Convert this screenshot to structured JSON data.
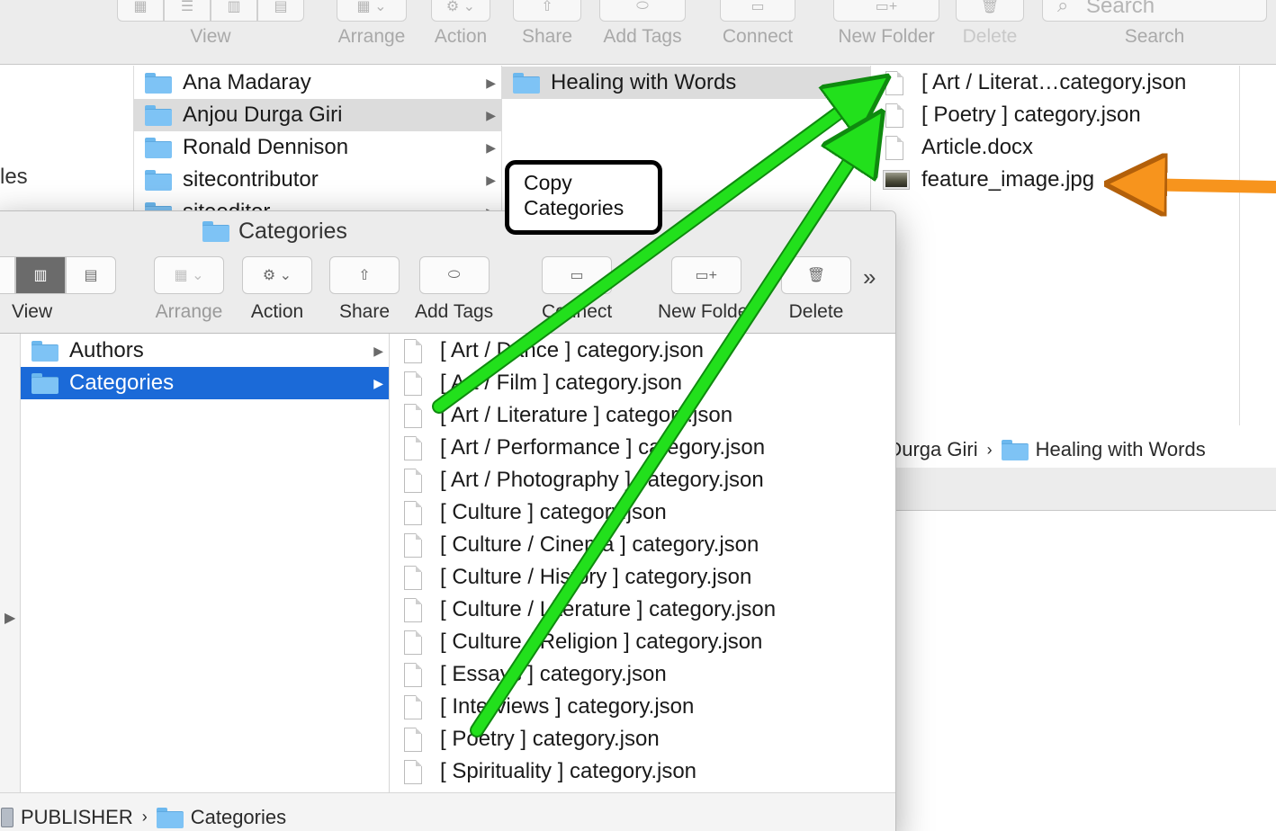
{
  "back_window": {
    "toolbar": {
      "view": "View",
      "arrange": "Arrange",
      "action": "Action",
      "share": "Share",
      "add_tags": "Add Tags",
      "connect": "Connect",
      "new_folder": "New Folder",
      "delete": "Delete",
      "search_placeholder": "Search",
      "search_label": "Search"
    },
    "sidebar_fragment": "les",
    "column1": [
      {
        "label": "Ana Madaray"
      },
      {
        "label": "Anjou Durga Giri"
      },
      {
        "label": "Ronald Dennison"
      },
      {
        "label": "sitecontributor"
      },
      {
        "label": "siteeditor"
      }
    ],
    "column2": [
      {
        "label": "Healing with Words"
      }
    ],
    "column3": [
      {
        "label": "[ Art / Literat…category.json",
        "kind": "doc"
      },
      {
        "label": "[ Poetry ] category.json",
        "kind": "doc"
      },
      {
        "label": "Article.docx",
        "kind": "doc"
      },
      {
        "label": "feature_image.jpg",
        "kind": "image"
      }
    ],
    "path": {
      "segment1": "u Durga Giri",
      "segment2": "Healing with Words"
    }
  },
  "front_window": {
    "title": "Categories",
    "toolbar": {
      "view": "View",
      "arrange": "Arrange",
      "action": "Action",
      "share": "Share",
      "add_tags": "Add Tags",
      "connect": "Connect",
      "new_folder": "New Folder",
      "delete": "Delete",
      "more": "»"
    },
    "column1": [
      {
        "label": "Authors"
      },
      {
        "label": "Categories"
      }
    ],
    "column2": [
      {
        "label": "[ Art / Dance ] category.json"
      },
      {
        "label": "[ Art / Film ] category.json"
      },
      {
        "label": "[ Art / Literature ] category.json"
      },
      {
        "label": "[ Art / Performance ] category.json"
      },
      {
        "label": "[ Art / Photography ] category.json"
      },
      {
        "label": "[ Culture ] category.json"
      },
      {
        "label": "[ Culture / Cinema ] category.json"
      },
      {
        "label": "[ Culture / History ] category.json"
      },
      {
        "label": "[ Culture / Literature ] category.json"
      },
      {
        "label": "[ Culture / Religion ] category.json"
      },
      {
        "label": "[ Essays ] category.json"
      },
      {
        "label": "[ Interviews ] category.json"
      },
      {
        "label": "[ Poetry ] category.json"
      },
      {
        "label": "[ Spirituality ] category.json"
      }
    ],
    "path": {
      "segment1": "PUBLISHER",
      "segment2": "Categories"
    }
  },
  "annotations": {
    "callout_line1": "Copy",
    "callout_line2": "Categories",
    "arrow_colors": {
      "green": "#22e01c",
      "orange": "#f7941d"
    }
  },
  "colors": {
    "selection_blue": "#1b6ad8",
    "selection_gray": "#dcdcdc",
    "toolbar_bg": "#ececec",
    "folder_blue": "#7ec3f5"
  }
}
